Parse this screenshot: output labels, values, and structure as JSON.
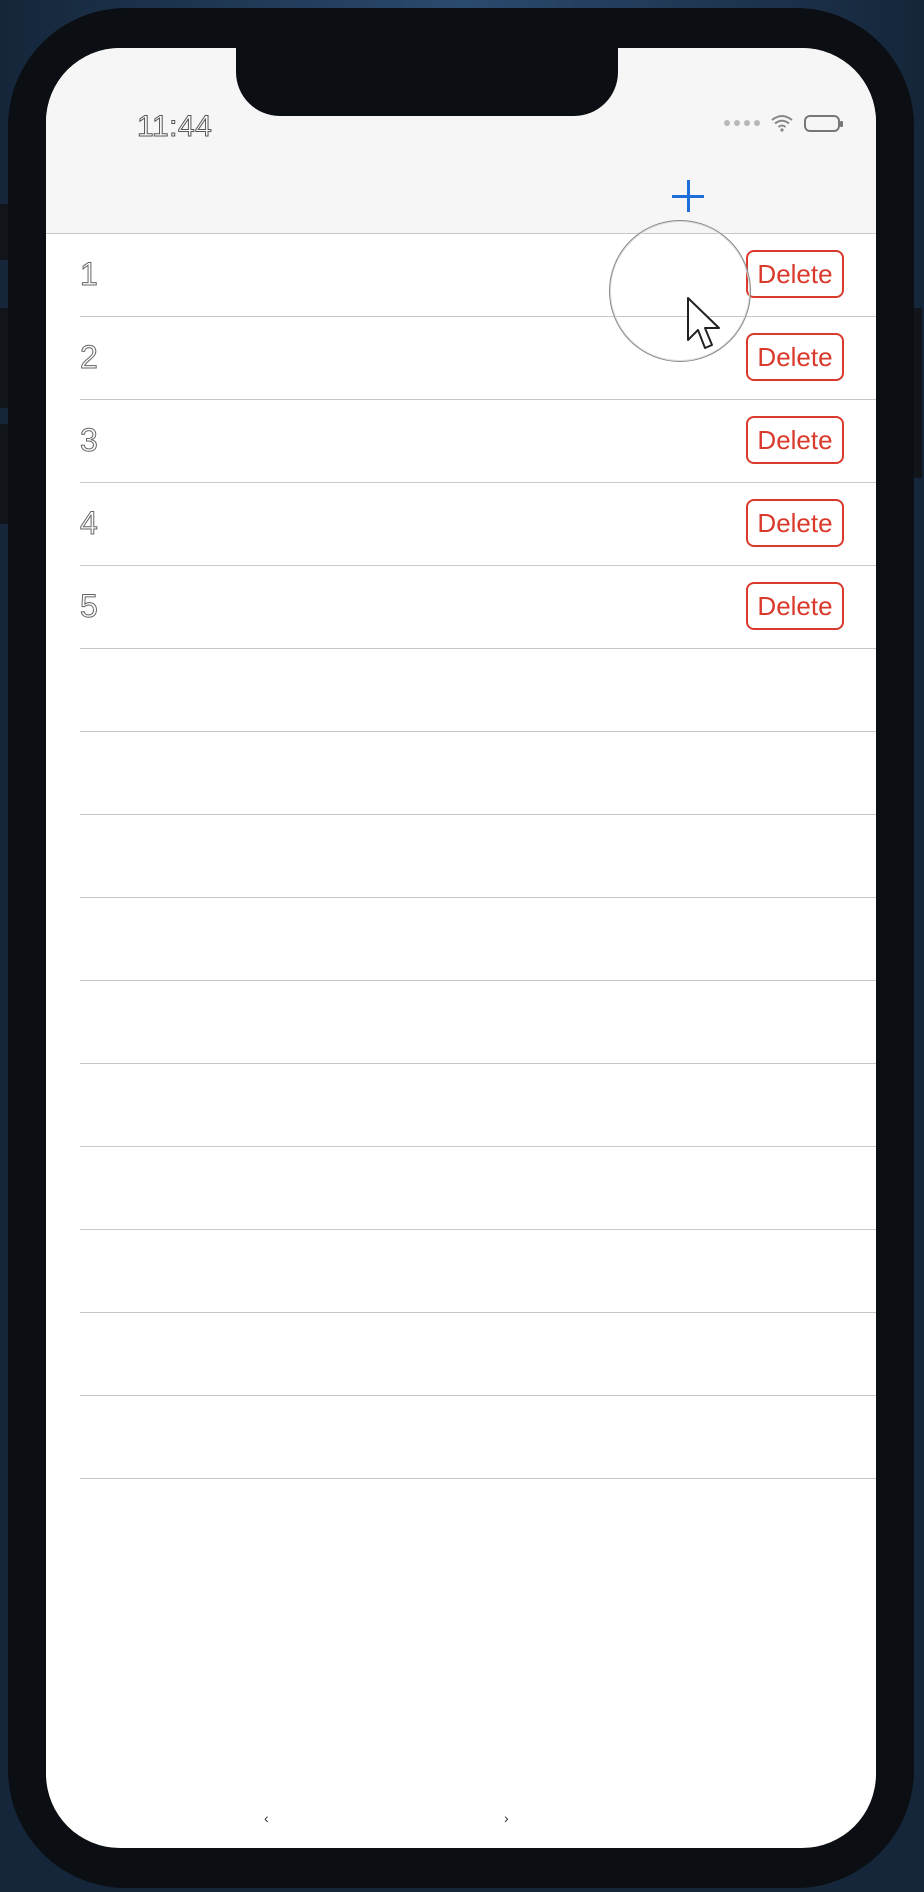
{
  "status_bar": {
    "time": "11:44",
    "wifi_icon": "wifi-icon",
    "battery_icon": "battery-icon"
  },
  "nav": {
    "add_icon": "plus-icon"
  },
  "rows": [
    {
      "label": "1",
      "delete_label": "Delete"
    },
    {
      "label": "2",
      "delete_label": "Delete"
    },
    {
      "label": "3",
      "delete_label": "Delete"
    },
    {
      "label": "4",
      "delete_label": "Delete"
    },
    {
      "label": "5",
      "delete_label": "Delete"
    }
  ],
  "empty_rows": 10,
  "home_bar": {
    "back_glyph": "‹",
    "forward_glyph": "›"
  },
  "colors": {
    "accent": "#1e6fd9",
    "destructive": "#d93a2b"
  }
}
